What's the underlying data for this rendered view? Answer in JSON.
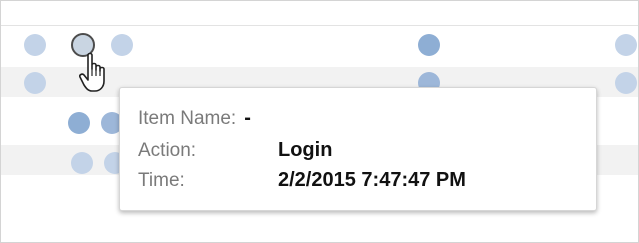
{
  "tooltip": {
    "item_name_label": "Item Name:",
    "item_name_value": "-",
    "action_label": "Action:",
    "action_value": "Login",
    "time_label": "Time:",
    "time_value": "2/2/2015 7:47:47 PM"
  },
  "colors": {
    "dot": "#c3d3e8",
    "dot_dark": "#8eaed4",
    "hover_outline": "#4c4c4c",
    "band": "#f2f2f2",
    "tooltip_label": "#7a7a7a",
    "tooltip_value": "#111111"
  },
  "icons": {
    "cursor": "hand-pointer-icon"
  }
}
